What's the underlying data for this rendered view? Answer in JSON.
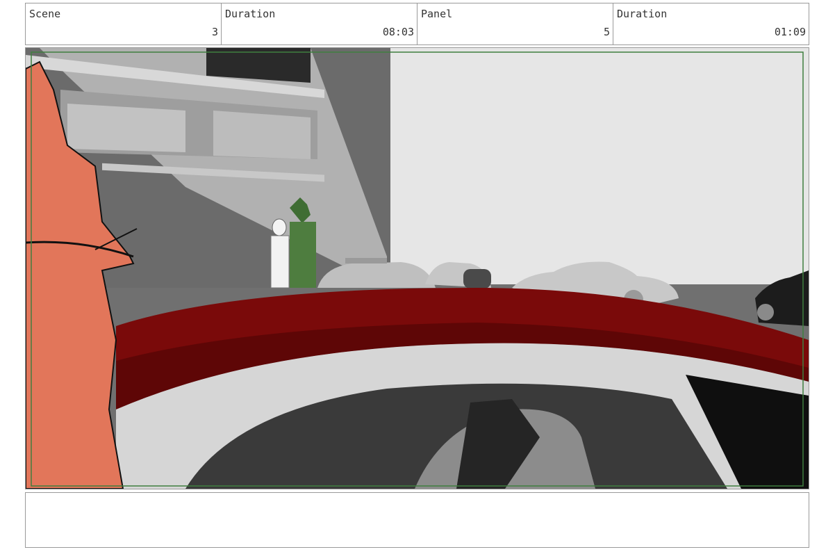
{
  "header": {
    "scene_label": "Scene",
    "scene_value": "3",
    "scene_duration_label": "Duration",
    "scene_duration_value": "08:03",
    "panel_label": "Panel",
    "panel_value": "5",
    "panel_duration_label": "Duration",
    "panel_duration_value": "01:09"
  },
  "notes": {
    "text": ""
  },
  "colors": {
    "safe_frame": "#3f7f3f",
    "car_roof": "#7a0a0a",
    "character_orange": "#e2765a",
    "character_green": "#4e7d3f"
  }
}
